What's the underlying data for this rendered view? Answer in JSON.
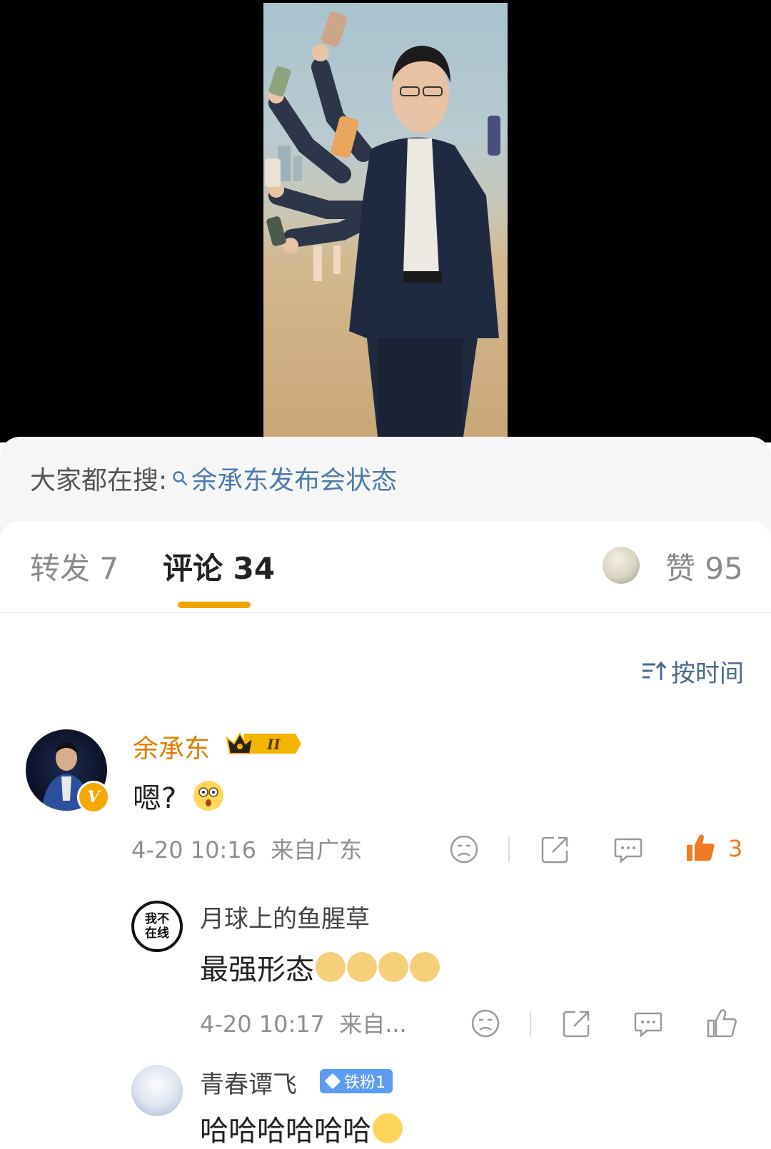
{
  "hot_search": {
    "label": "大家都在搜:",
    "query": "余承东发布会状态"
  },
  "tabs": {
    "repost": "转发 7",
    "comment": "评论 34",
    "like": "赞 95"
  },
  "sort": {
    "label": "按时间"
  },
  "comments": [
    {
      "user": "余承东",
      "level_badge": "II",
      "text": "嗯?",
      "time": "4-20 10:16",
      "location": "来自广东",
      "likes": "3",
      "emoji": "shocked-emoji"
    }
  ],
  "replies": [
    {
      "user": "月球上的鱼腥草",
      "avatar_text": "我不在线",
      "text": "最强形态",
      "emoji": "doge-emoji",
      "time": "4-20 10:17",
      "location": "来自..."
    },
    {
      "user": "青春谭飞",
      "fan_badge": "铁粉1",
      "text": "哈哈哈哈哈哈",
      "emoji": "laugh-cry-emoji"
    }
  ],
  "colors": {
    "accent": "#f0a400",
    "link": "#4f7cab",
    "like": "#f07b22"
  }
}
